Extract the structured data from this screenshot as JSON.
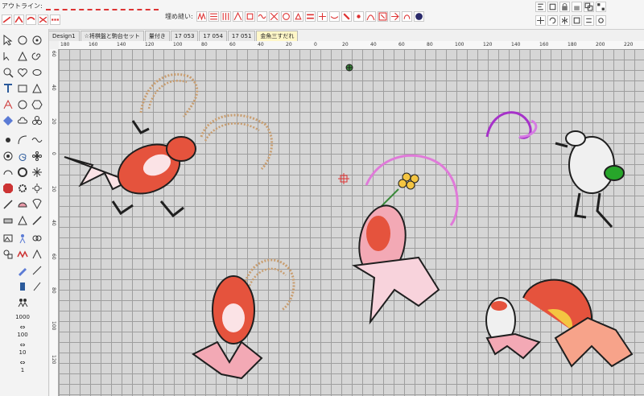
{
  "toolbar": {
    "outline_label": "アウトライン:",
    "fill_label": "埋め縫い:"
  },
  "tabs": [
    {
      "label": "Design1"
    },
    {
      "label": "☆将棋盤と駒台セット"
    },
    {
      "label": "量付き"
    },
    {
      "label": "17 053"
    },
    {
      "label": "17 054"
    },
    {
      "label": "17 051"
    },
    {
      "label": "金魚三すだれ"
    }
  ],
  "left_tools": {
    "count_1000": "1000",
    "count_100": "100",
    "count_10": "10",
    "count_1": "1"
  },
  "ruler": {
    "h_ticks": [
      "180",
      "160",
      "140",
      "120",
      "100",
      "80",
      "60",
      "40",
      "20",
      "0",
      "20",
      "40",
      "60",
      "80",
      "100",
      "120",
      "140",
      "160",
      "180",
      "200",
      "220"
    ],
    "v_ticks": [
      "60",
      "40",
      "20",
      "0",
      "20",
      "40",
      "60",
      "80",
      "100",
      "120"
    ]
  },
  "colors": {
    "canvas_bg": "#d6d6d6",
    "grid": "#9e9e9e",
    "goldfish_red": "#e5533d",
    "goldfish_pink": "#f3a9b5",
    "straw": "#c89d6f",
    "outline": "#1f1f1f",
    "ribbon": "#d67be3",
    "frog_green": "#27a52a"
  }
}
